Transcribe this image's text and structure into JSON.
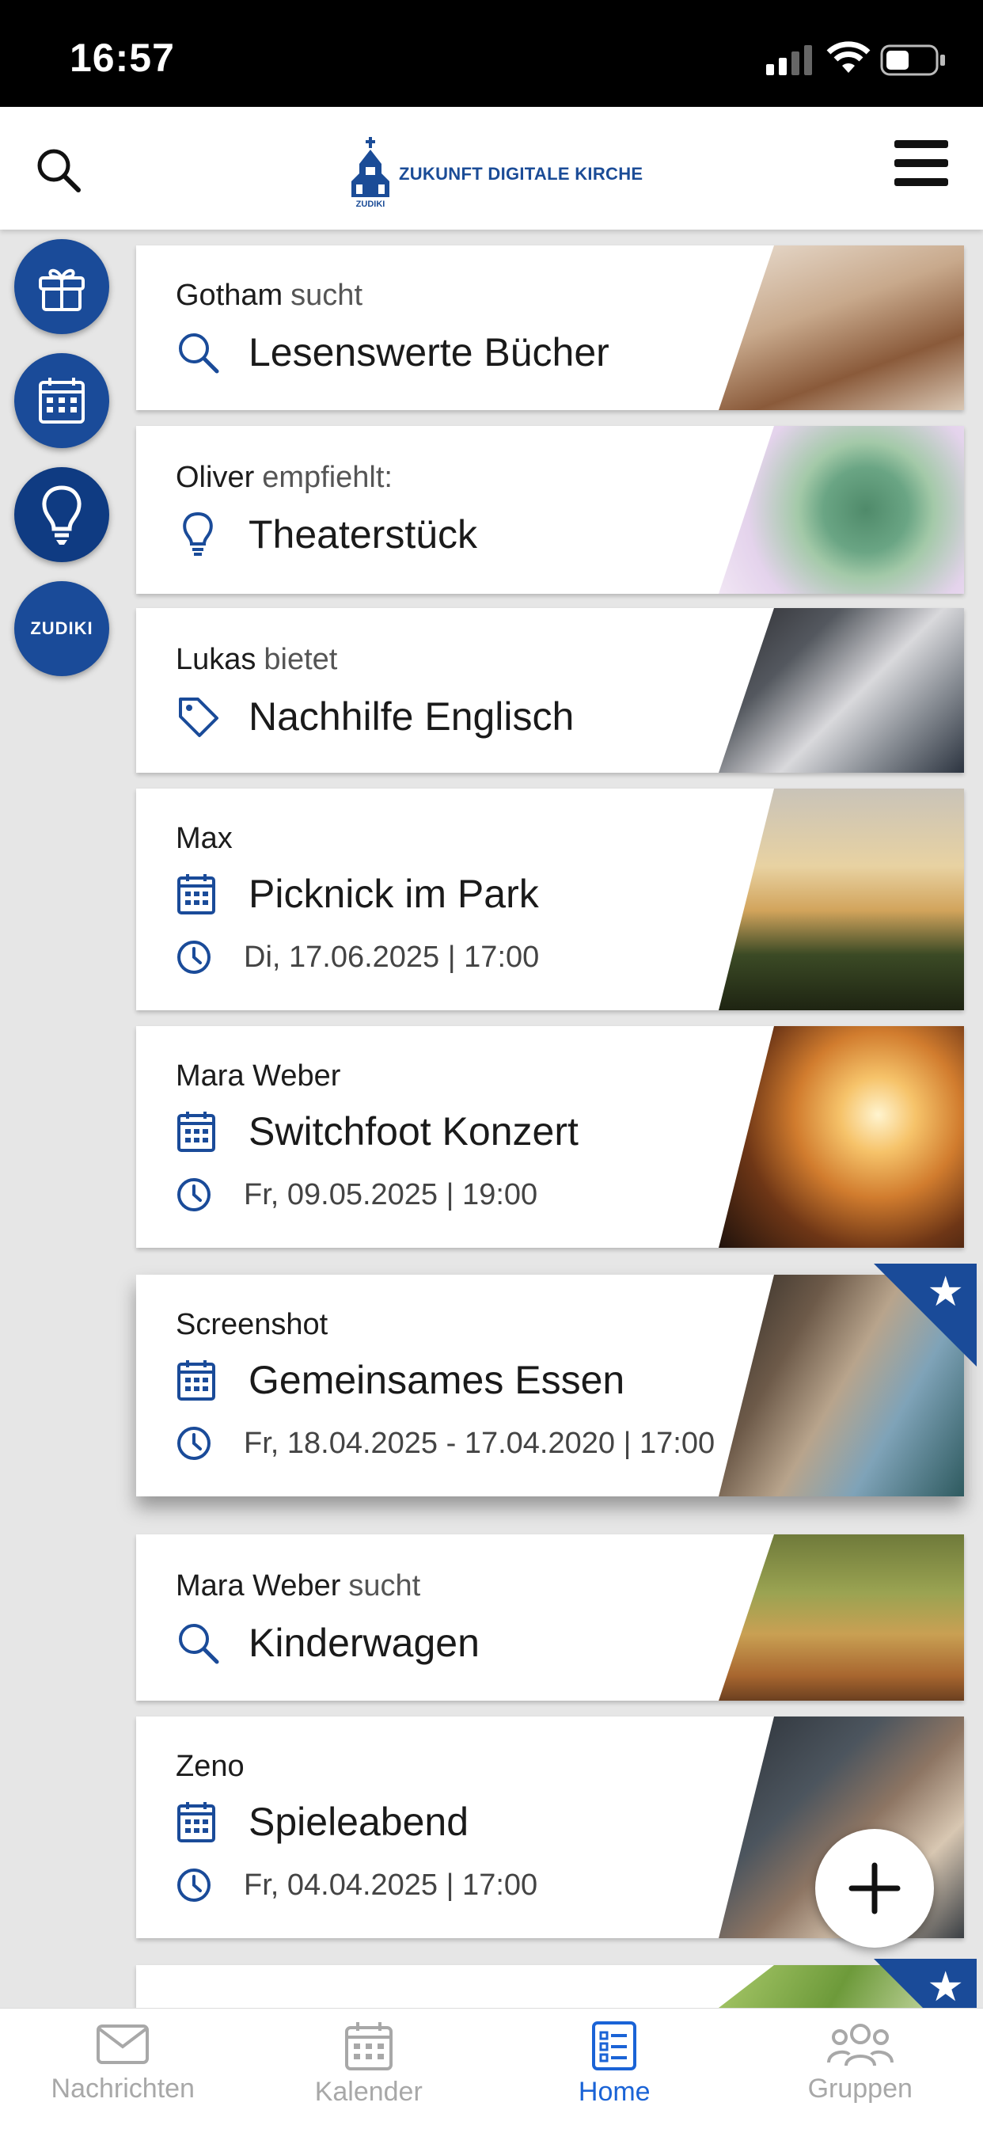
{
  "status": {
    "time": "16:57"
  },
  "header": {
    "logo_text": "ZUKUNFT DIGITALE KIRCHE",
    "logo_subtext": "ZUDIKI"
  },
  "sidebar": {
    "zudiki_label": "ZUDIKI"
  },
  "cards": [
    {
      "author": "Gotham",
      "verb": "sucht",
      "title": "Lesenswerte Bücher",
      "icon": "search-icon"
    },
    {
      "author": "Oliver",
      "verb": "empfiehlt:",
      "title": "Theaterstück",
      "icon": "lightbulb-icon"
    },
    {
      "author": "Lukas",
      "verb": "bietet",
      "title": "Nachhilfe Englisch",
      "icon": "tag-icon"
    },
    {
      "author": "Max",
      "title": "Picknick im Park",
      "date": "Di, 17.06.2025 | 17:00",
      "icon": "calendar-icon"
    },
    {
      "author": "Mara Weber",
      "title": "Switchfoot Konzert",
      "date": "Fr, 09.05.2025 | 19:00",
      "icon": "calendar-icon"
    },
    {
      "author": "Screenshot",
      "title": "Gemeinsames Essen",
      "date": "Fr, 18.04.2025 - 17.04.2020 | 17:00",
      "icon": "calendar-icon",
      "featured": true
    },
    {
      "author": "Mara Weber",
      "verb": "sucht",
      "title": "Kinderwagen",
      "icon": "search-icon"
    },
    {
      "author": "Zeno",
      "title": "Spieleabend",
      "date": "Fr, 04.04.2025 | 17:00",
      "icon": "calendar-icon"
    }
  ],
  "tabs": [
    {
      "label": "Nachrichten",
      "icon": "mail-icon"
    },
    {
      "label": "Kalender",
      "icon": "calendar-icon"
    },
    {
      "label": "Home",
      "icon": "list-icon",
      "active": true
    },
    {
      "label": "Gruppen",
      "icon": "group-icon"
    }
  ],
  "colors": {
    "brand": "#1a4b99",
    "active_tab": "#1a63d6"
  }
}
